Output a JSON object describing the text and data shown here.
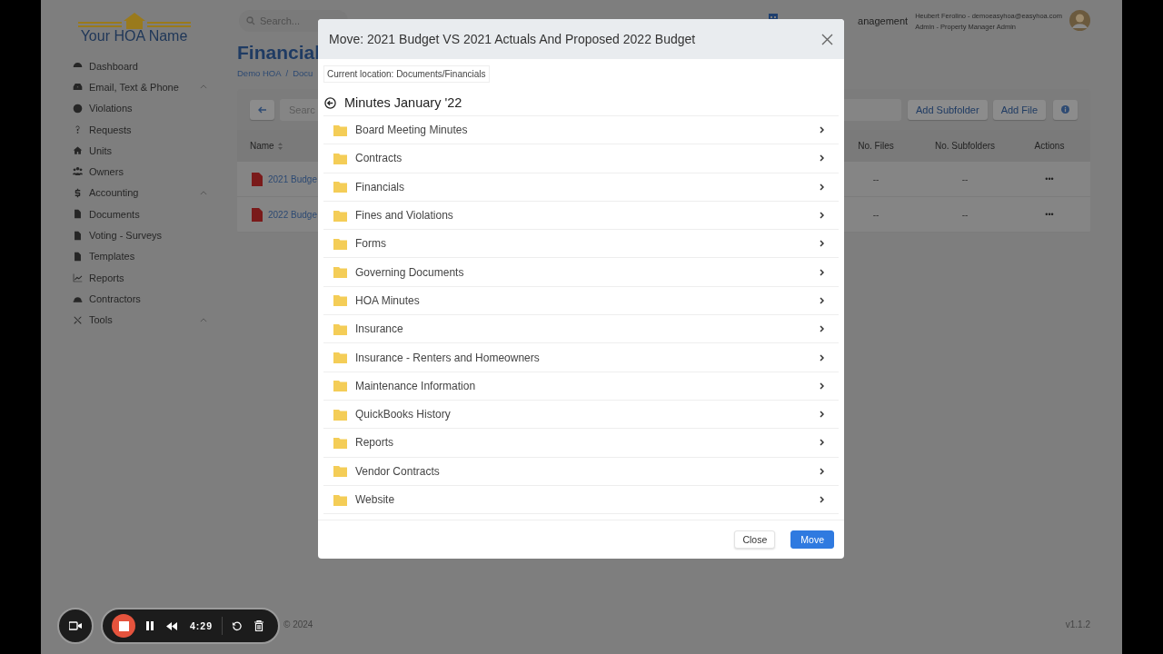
{
  "sidebar": {
    "logo": "Your HOA Name",
    "items": [
      {
        "label": "Dashboard",
        "has_submenu": false
      },
      {
        "label": "Email, Text & Phone",
        "has_submenu": true
      },
      {
        "label": "Violations",
        "has_submenu": false
      },
      {
        "label": "Requests",
        "has_submenu": false
      },
      {
        "label": "Units",
        "has_submenu": false
      },
      {
        "label": "Owners",
        "has_submenu": false
      },
      {
        "label": "Accounting",
        "has_submenu": true
      },
      {
        "label": "Documents",
        "has_submenu": false
      },
      {
        "label": "Voting - Surveys",
        "has_submenu": false
      },
      {
        "label": "Templates",
        "has_submenu": false
      },
      {
        "label": "Reports",
        "has_submenu": false
      },
      {
        "label": "Contractors",
        "has_submenu": false
      },
      {
        "label": "Tools",
        "has_submenu": true
      }
    ]
  },
  "topbar": {
    "search": {
      "placeholder": "Search..."
    },
    "brand_fragment": "anagement",
    "user": "Heubert Ferolino - demoeasyhoa@easyhoa.com",
    "role": "Admin - Property Manager Admin"
  },
  "page": {
    "title": "Financial",
    "breadcrumb": [
      "Demo HOA",
      "Docu"
    ],
    "breadcrumb_separator": "/",
    "toolbar": {
      "search_placeholder": "Searc",
      "buttons": [
        "Add Subfolder",
        "Add File"
      ]
    },
    "table": {
      "columns": [
        "Name",
        "No. Files",
        "No. Subfolders",
        "Actions"
      ],
      "rows": [
        {
          "name": "2021 Budge",
          "files": "--",
          "subfolders": "--",
          "actions": "•••"
        },
        {
          "name": "2022 Budge",
          "files": "--",
          "subfolders": "--",
          "actions": "•••"
        }
      ]
    }
  },
  "modal": {
    "title": "Move: 2021 Budget VS 2021 Actuals And Proposed 2022 Budget",
    "location": "Current location: Documents/Financials",
    "folder": "Minutes January '22",
    "subfolders": [
      "Board Meeting Minutes",
      "Contracts",
      "Financials",
      "Fines and Violations",
      "Forms",
      "Governing Documents",
      "HOA Minutes",
      "Insurance",
      "Insurance - Renters and Homeowners",
      "Maintenance Information",
      "QuickBooks History",
      "Reports",
      "Vendor Contracts",
      "Website"
    ],
    "buttons": [
      "Close",
      "Move"
    ]
  },
  "recorder": {
    "time": "4:29"
  },
  "footer": {
    "copyright": "© 2024",
    "version": "v1.1.2"
  }
}
